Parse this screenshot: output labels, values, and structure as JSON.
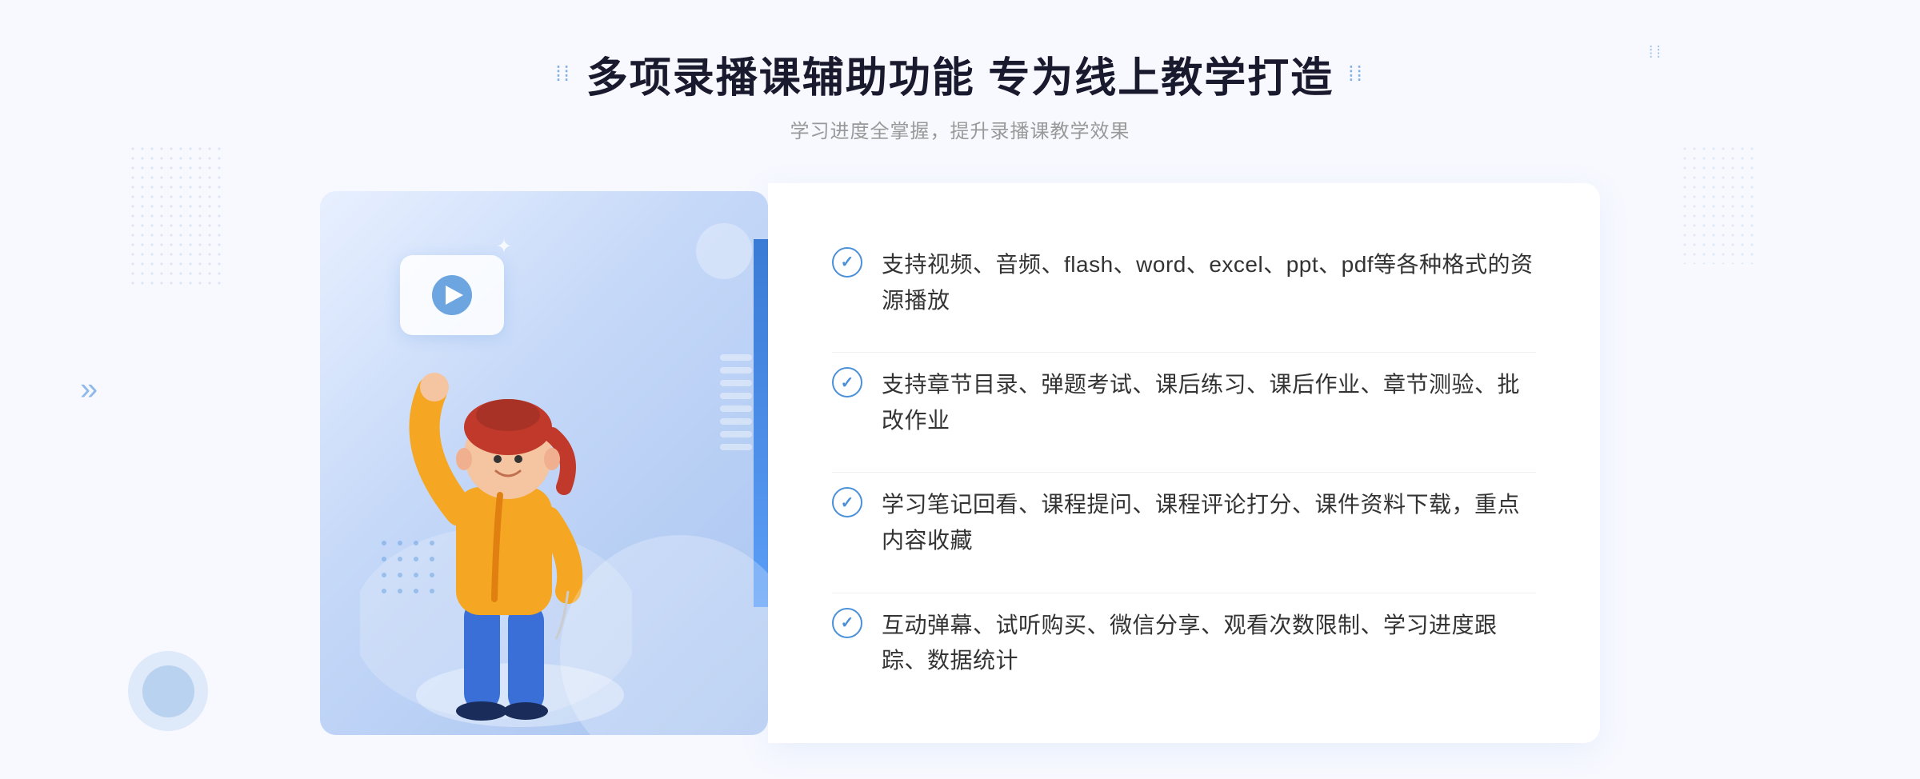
{
  "header": {
    "title_dots_left": "⁞⁞",
    "title_dots_right": "⁞⁞",
    "main_title": "多项录播课辅助功能 专为线上教学打造",
    "subtitle": "学习进度全掌握，提升录播课教学效果"
  },
  "features": [
    {
      "id": 1,
      "text": "支持视频、音频、flash、word、excel、ppt、pdf等各种格式的资源播放"
    },
    {
      "id": 2,
      "text": "支持章节目录、弹题考试、课后练习、课后作业、章节测验、批改作业"
    },
    {
      "id": 3,
      "text": "学习笔记回看、课程提问、课程评论打分、课件资料下载，重点内容收藏"
    },
    {
      "id": 4,
      "text": "互动弹幕、试听购买、微信分享、观看次数限制、学习进度跟踪、数据统计"
    }
  ],
  "decorative": {
    "chevron": "»",
    "sparkle": "✦"
  }
}
